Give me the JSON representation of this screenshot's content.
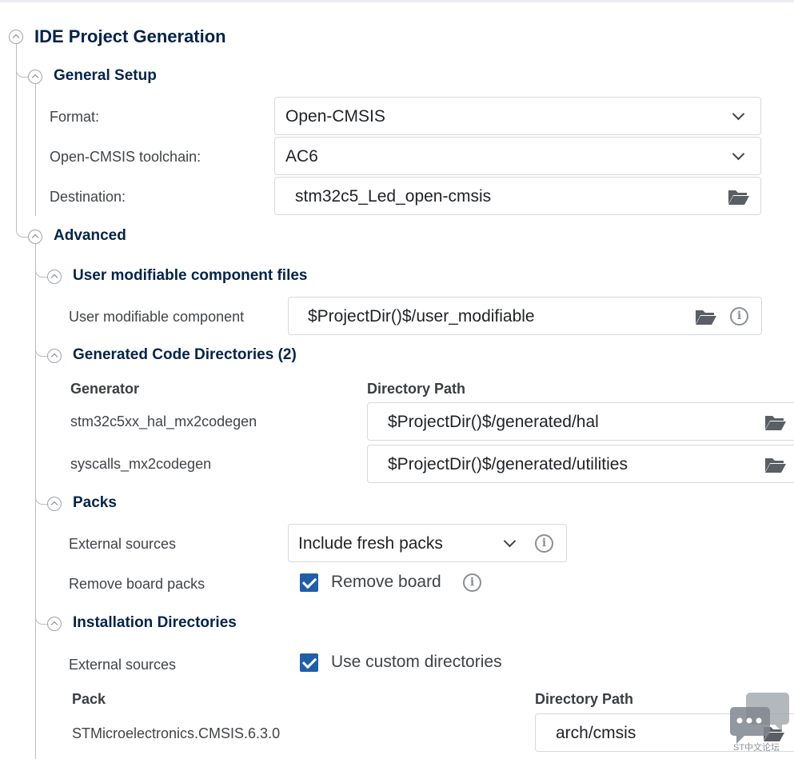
{
  "root": {
    "title": "IDE Project Generation"
  },
  "general_setup": {
    "title": "General Setup",
    "format": {
      "label": "Format:",
      "value": "Open-CMSIS"
    },
    "toolchain": {
      "label": "Open-CMSIS toolchain:",
      "value": "AC6"
    },
    "destination": {
      "label": "Destination:",
      "value": "stm32c5_Led_open-cmsis"
    }
  },
  "advanced": {
    "title": "Advanced",
    "user_modifiable": {
      "title": "User modifiable component files",
      "label": "User modifiable component",
      "value": "$ProjectDir()$/user_modifiable"
    },
    "generated_code": {
      "title": "Generated Code Directories (2)",
      "columns": [
        "Generator",
        "Directory Path"
      ],
      "rows": [
        {
          "generator": "stm32c5xx_hal_mx2codegen",
          "path": "$ProjectDir()$/generated/hal"
        },
        {
          "generator": "syscalls_mx2codegen",
          "path": "$ProjectDir()$/generated/utilities"
        }
      ]
    },
    "packs": {
      "title": "Packs",
      "external_sources": {
        "label": "External sources",
        "value": "Include fresh packs"
      },
      "remove_board": {
        "label": "Remove board packs",
        "checkbox_label": "Remove board",
        "checked": true
      }
    },
    "installation": {
      "title": "Installation Directories",
      "external_sources": {
        "label": "External sources",
        "checkbox_label": "Use custom directories",
        "checked": true
      },
      "columns": [
        "Pack",
        "Directory Path"
      ],
      "rows": [
        {
          "pack": "STMicroelectronics.CMSIS.6.3.0",
          "path": "arch/cmsis"
        }
      ]
    }
  },
  "watermark": {
    "text": "ST中文论坛"
  },
  "colors": {
    "heading": "#03234b",
    "checkbox": "#1f5fa8",
    "border": "#d6d9dd"
  },
  "icons": [
    "collapse-icon",
    "chevron-down-icon",
    "folder-open-icon",
    "info-icon",
    "checkbox-checked-icon",
    "chat-bubble-icon"
  ]
}
